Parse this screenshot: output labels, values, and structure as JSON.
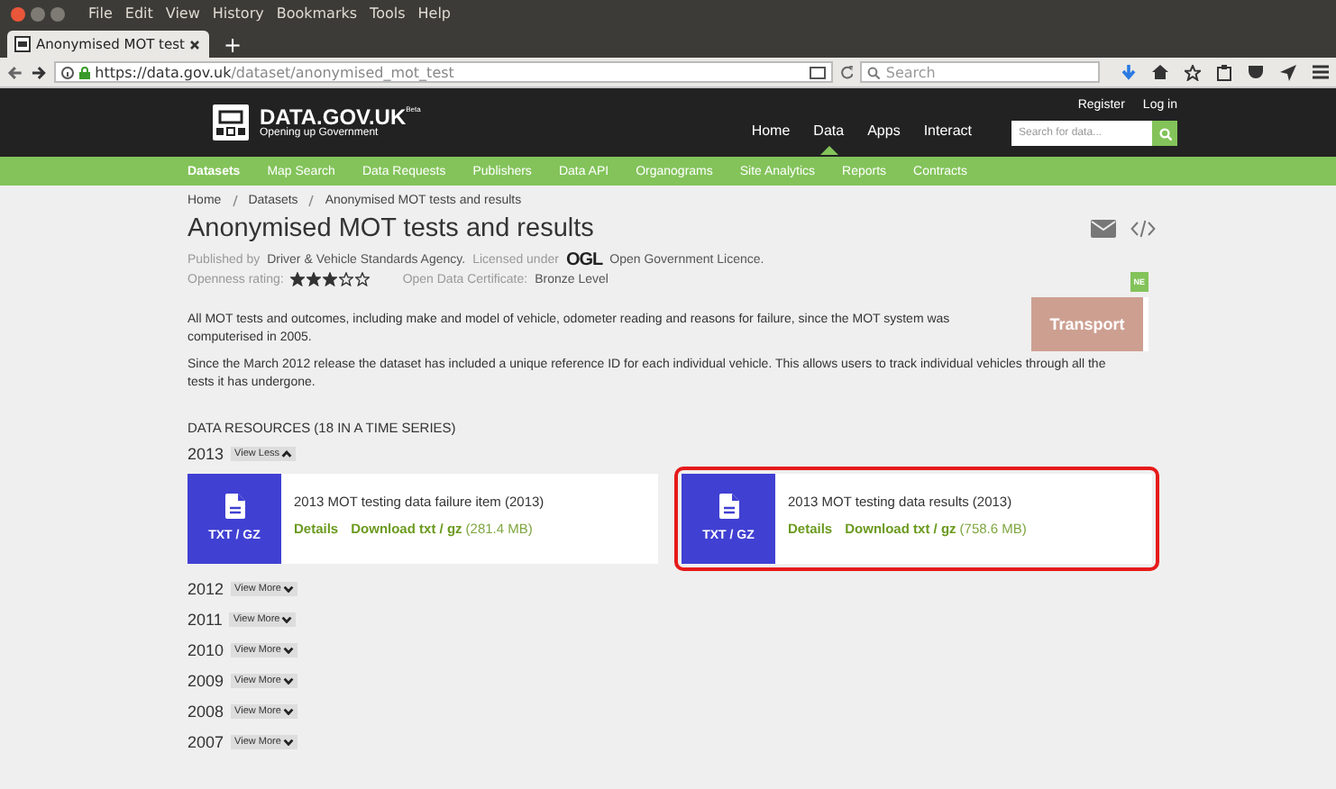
{
  "browser": {
    "menu": [
      "File",
      "Edit",
      "View",
      "History",
      "Bookmarks",
      "Tools",
      "Help"
    ],
    "tab": {
      "title": "Anonymised MOT test",
      "selected": true
    },
    "new_tab": "+",
    "url": {
      "host": "https://data.gov.uk",
      "path": "/dataset/anonymised_mot_test"
    },
    "search": {
      "placeholder": "Search"
    }
  },
  "site": {
    "logo": "DATA.GOV.UK",
    "beta": "Beta",
    "tagline": "Opening up Government",
    "account": [
      "Register",
      "Log in"
    ],
    "nav": [
      {
        "label": "Home",
        "selected": false
      },
      {
        "label": "Data",
        "selected": true
      },
      {
        "label": "Apps",
        "selected": false
      },
      {
        "label": "Interact",
        "selected": false
      }
    ],
    "search": {
      "placeholder": "Search for data..."
    }
  },
  "subnav": [
    {
      "label": "Datasets",
      "selected": true
    },
    {
      "label": "Map Search",
      "selected": false
    },
    {
      "label": "Data Requests",
      "selected": false
    },
    {
      "label": "Publishers",
      "selected": false
    },
    {
      "label": "Data API",
      "selected": false
    },
    {
      "label": "Organograms",
      "selected": false
    },
    {
      "label": "Site Analytics",
      "selected": false
    },
    {
      "label": "Reports",
      "selected": false
    },
    {
      "label": "Contracts",
      "selected": false
    }
  ],
  "breadcrumb": [
    "Home",
    "Datasets",
    "Anonymised MOT tests and results"
  ],
  "title": "Anonymised MOT tests and results",
  "published": {
    "label": "Published by",
    "publisher": "Driver & Vehicle Standards Agency.",
    "licence_label": "Licensed under",
    "licence_logo": "OGL",
    "licence": "Open Government Licence."
  },
  "openness": {
    "label": "Openness rating:",
    "stars": 3,
    "certificate_label": "Open Data Certificate:",
    "certificate": "Bronze Level"
  },
  "badge": "NE",
  "theme": "Transport",
  "description": [
    "All MOT tests and outcomes, including make and model of vehicle, odometer reading and reasons for failure, since the MOT system was computerised in 2005.",
    "Since the March 2012 release the dataset has included a unique reference ID for each individual vehicle. This allows users to track individual vehicles through all the tests it has undergone."
  ],
  "resources": {
    "heading": "DATA RESOURCES (18 IN A TIME SERIES)",
    "years": [
      {
        "year": "2013",
        "expanded": true,
        "toggle": "View Less",
        "items": [
          {
            "format": "TXT / GZ",
            "title": "2013 MOT testing data failure item (2013)",
            "details": "Details",
            "download": "Download txt / gz",
            "size": "(281.4 MB)",
            "highlighted": false
          },
          {
            "format": "TXT / GZ",
            "title": "2013 MOT testing data results (2013)",
            "details": "Details",
            "download": "Download txt / gz",
            "size": "(758.6 MB)",
            "highlighted": true
          }
        ]
      },
      {
        "year": "2012",
        "expanded": false,
        "toggle": "View More"
      },
      {
        "year": "2011",
        "expanded": false,
        "toggle": "View More"
      },
      {
        "year": "2010",
        "expanded": false,
        "toggle": "View More"
      },
      {
        "year": "2009",
        "expanded": false,
        "toggle": "View More"
      },
      {
        "year": "2008",
        "expanded": false,
        "toggle": "View More"
      },
      {
        "year": "2007",
        "expanded": false,
        "toggle": "View More"
      }
    ]
  }
}
